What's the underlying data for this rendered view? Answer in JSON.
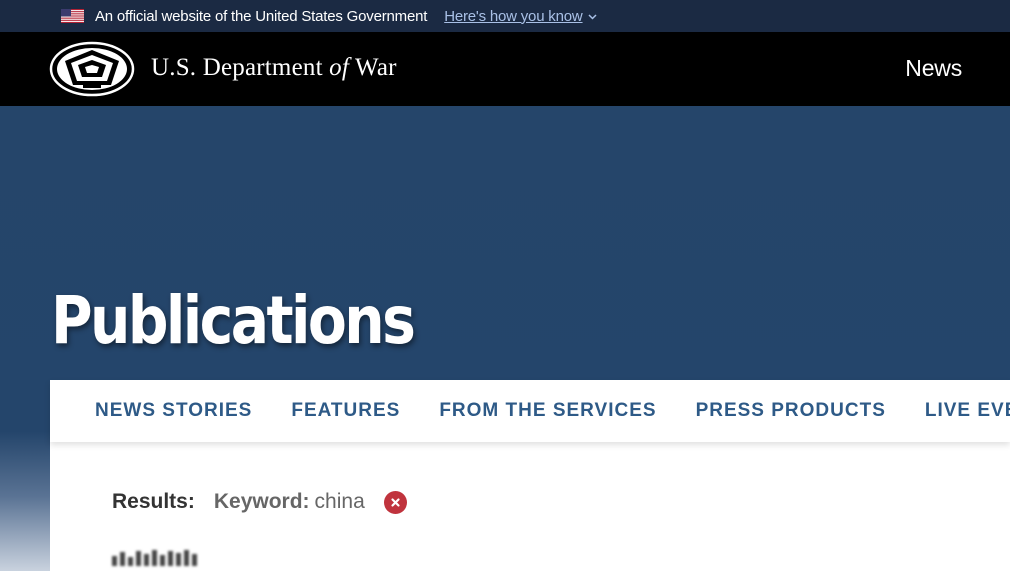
{
  "gov_banner": {
    "text": "An official website of the United States Government",
    "link": "Here's how you know"
  },
  "header": {
    "title_pre": "U.S. Department ",
    "title_of": "of",
    "title_post": " War",
    "nav_news": "News"
  },
  "hero": {
    "title": "Publications"
  },
  "tabs": [
    {
      "label": "NEWS STORIES"
    },
    {
      "label": "FEATURES"
    },
    {
      "label": "FROM THE SERVICES"
    },
    {
      "label": "PRESS PRODUCTS"
    },
    {
      "label": "LIVE EVENTS"
    }
  ],
  "results": {
    "label": "Results:",
    "keyword_label": "Keyword:",
    "keyword_value": "china"
  },
  "colors": {
    "banner_bg": "#1b2a43",
    "header_bg": "#000000",
    "hero_bg": "#24456b",
    "tab_text": "#2e5a87",
    "clear_button": "#c0333d"
  },
  "icons": [
    "us-flag-icon",
    "chevron-down-icon",
    "pentagon-seal-icon",
    "close-icon"
  ]
}
